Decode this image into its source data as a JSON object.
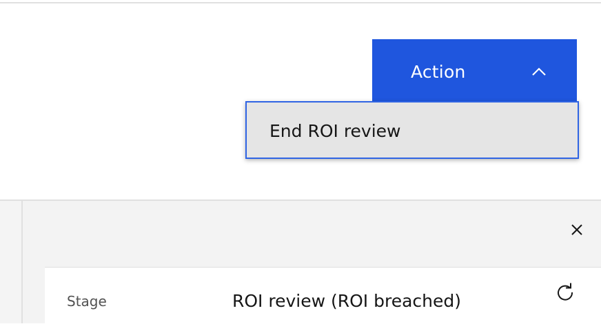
{
  "header": {
    "action_button": {
      "label": "Action",
      "icon": "chevron-up-icon",
      "expanded": true
    },
    "dropdown": {
      "items": [
        {
          "label": "End ROI review"
        }
      ]
    }
  },
  "side_panel": {
    "close_icon": "close-icon",
    "refresh_icon": "refresh-icon",
    "fields": [
      {
        "label": "Stage",
        "value": "ROI review (ROI breached)"
      }
    ]
  },
  "colors": {
    "primary": "#1f56de",
    "focus_border": "#2f64e4",
    "menu_bg": "#e5e5e5",
    "panel_bg": "#f3f3f3",
    "text_primary": "#161616",
    "text_secondary": "#525252"
  }
}
